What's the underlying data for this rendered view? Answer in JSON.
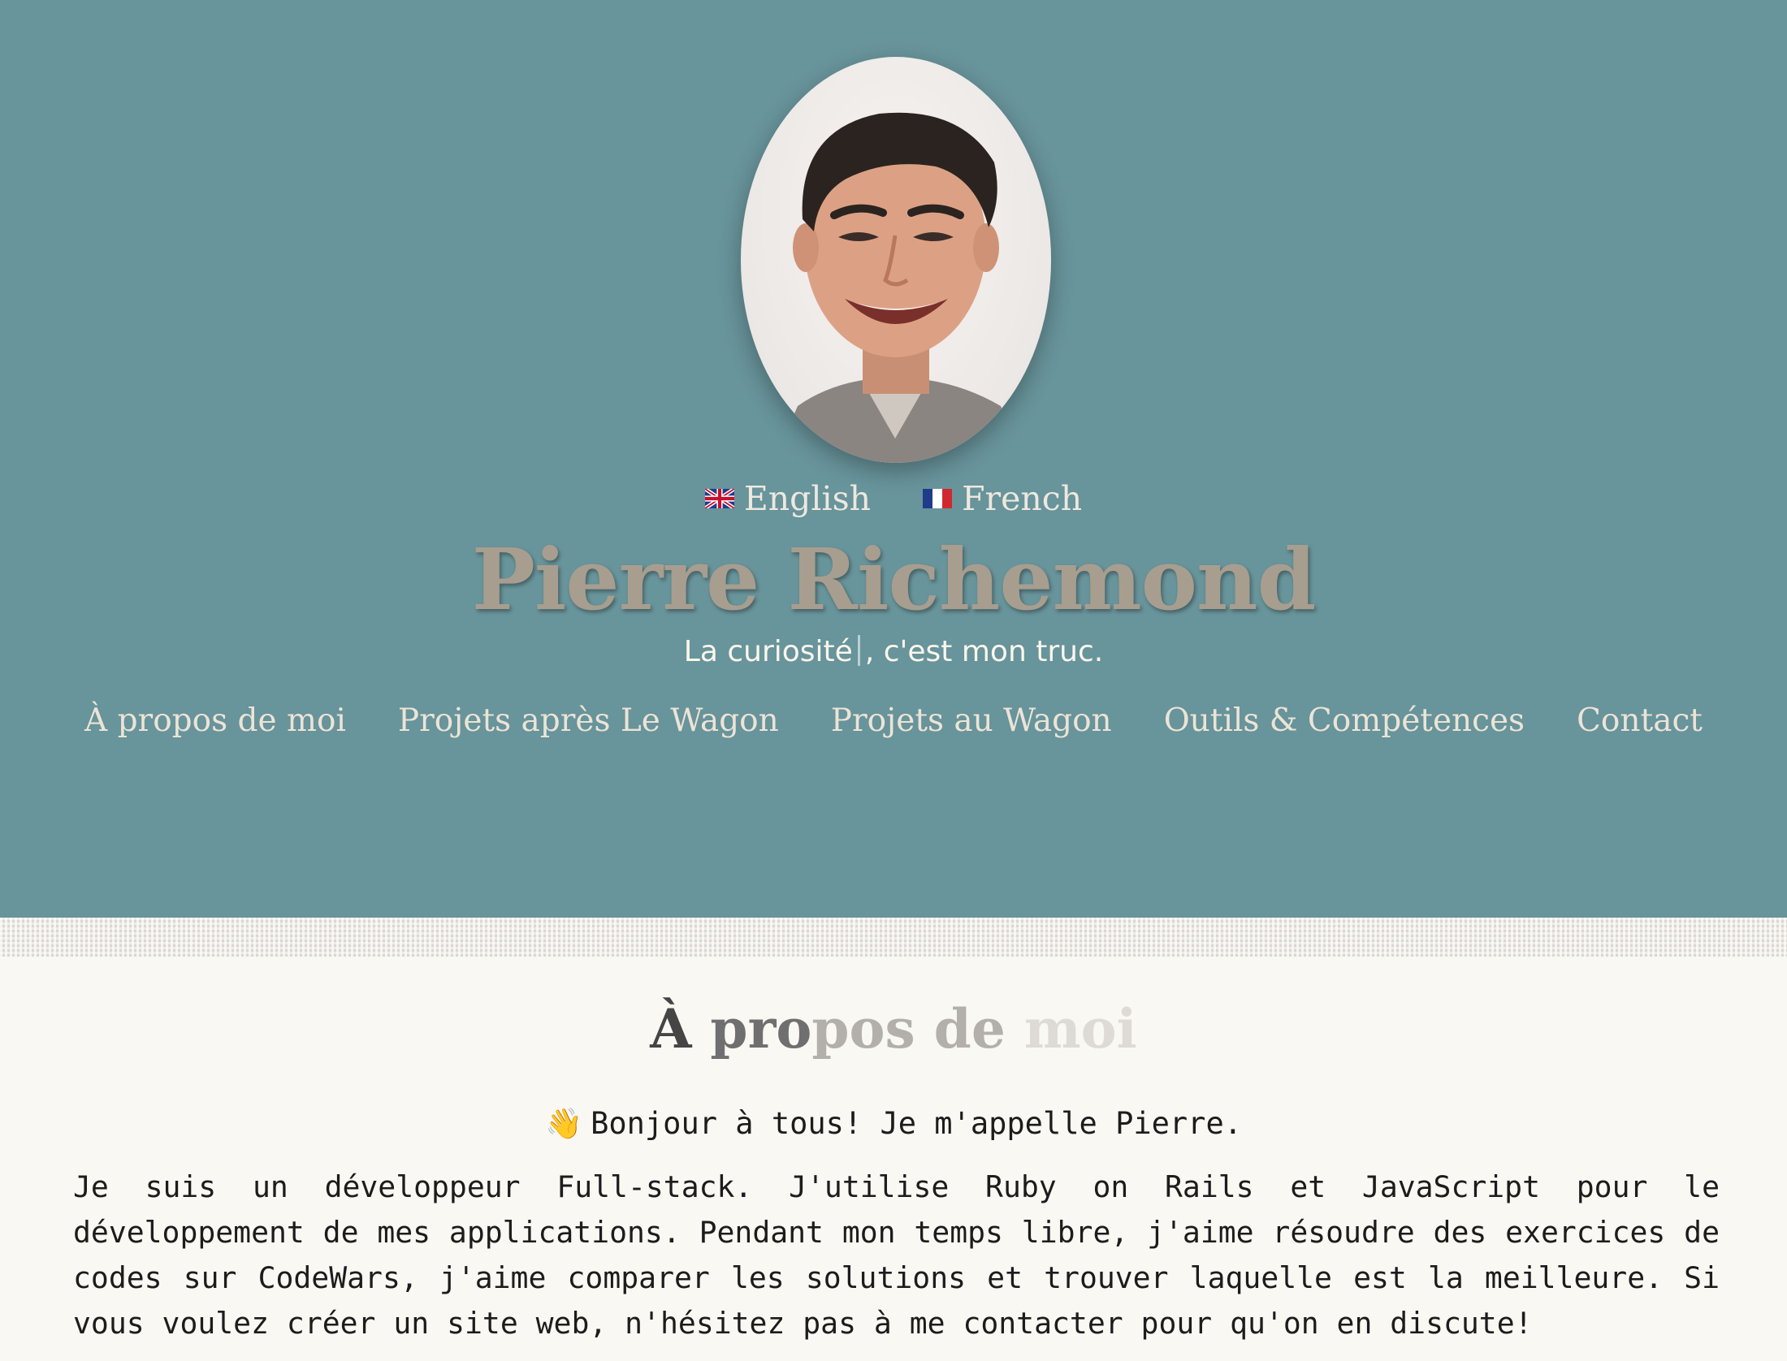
{
  "header": {
    "photo_alt": "Pierre Richemond",
    "languages": [
      {
        "label": "English",
        "flag": "uk-flag-icon"
      },
      {
        "label": "French",
        "flag": "france-flag-icon"
      }
    ],
    "name": "Pierre Richemond",
    "tagline_word": "La curiosité",
    "tagline_rest": ", c'est mon truc."
  },
  "nav": {
    "items": [
      "À propos de moi",
      "Projets après Le Wagon",
      "Projets au Wagon",
      "Outils & Compétences",
      "Contact"
    ]
  },
  "about": {
    "title_parts": [
      "À ",
      "pro",
      "pos",
      " de ",
      "moi"
    ],
    "greeting_emoji": "👋",
    "greeting": "Bonjour à tous! Je m'appelle Pierre.",
    "bio": "Je suis un développeur Full-stack. J'utilise Ruby on Rails et JavaScript pour le développement de mes applications. Pendant mon temps libre, j'aime résoudre des exercices de codes sur CodeWars, j'aime comparer les solutions et trouver laquelle est la meilleure. Si vous voulez créer un site web, n'hésitez pas à me contacter pour qu'on en discute!"
  },
  "colors": {
    "hero_bg": "#68949b",
    "page_bg": "#faf8f3",
    "name_color": "#a79e8f",
    "nav_color": "#ece4d6"
  }
}
